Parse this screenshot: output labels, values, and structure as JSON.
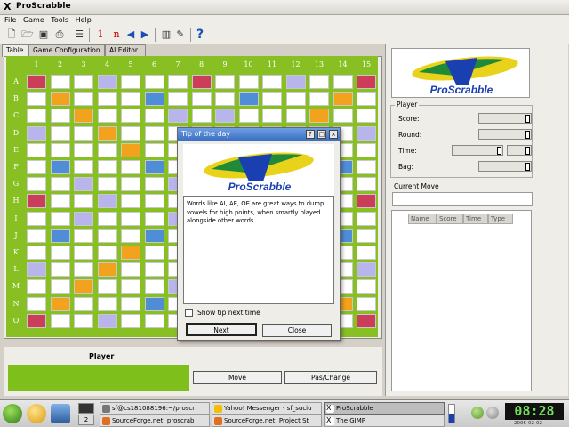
{
  "window": {
    "title": "ProScrabble"
  },
  "menu": [
    "File",
    "Game",
    "Tools",
    "Help"
  ],
  "toolbar": {
    "one": "1",
    "n": "n"
  },
  "tabs": [
    "Table",
    "Game Configuration",
    "AI Editor"
  ],
  "board": {
    "columns": [
      "1",
      "2",
      "3",
      "4",
      "5",
      "6",
      "7",
      "8",
      "9",
      "10",
      "11",
      "12",
      "13",
      "14",
      "15"
    ],
    "rows": [
      "A",
      "B",
      "C",
      "D",
      "E",
      "F",
      "G",
      "H",
      "I",
      "J",
      "K",
      "L",
      "M",
      "N",
      "O"
    ]
  },
  "player_panel": {
    "label": "Player",
    "move_button": "Move",
    "pass_button": "Pas/Change"
  },
  "right": {
    "player_group": "Player",
    "score_label": "Score:",
    "round_label": "Round:",
    "time_label": "Time:",
    "bag_label": "Bag:",
    "current_move_group": "Current Move",
    "list_headers": [
      "Name",
      "Score",
      "Time",
      "Type"
    ]
  },
  "logo_text": "ProScrabble",
  "dialog": {
    "title": "Tip of the day",
    "tip": "Words like AI, AE, OE are great ways to dump vowels for high points, when smartly played alongside other words.",
    "checkbox_label": "Show tip next time",
    "next_button": "Next",
    "close_button": "Close"
  },
  "taskbar": {
    "desktop_number": "2",
    "tasks": [
      "sf@cs181088196:~/proscr",
      "Yahoo! Messenger - sf_suciu",
      "ProScrabble",
      "SourceForge.net: proscrab",
      "SourceForge.net: Project St",
      "The GIMP"
    ],
    "clock": "08:28",
    "date": "2005-02-02"
  }
}
